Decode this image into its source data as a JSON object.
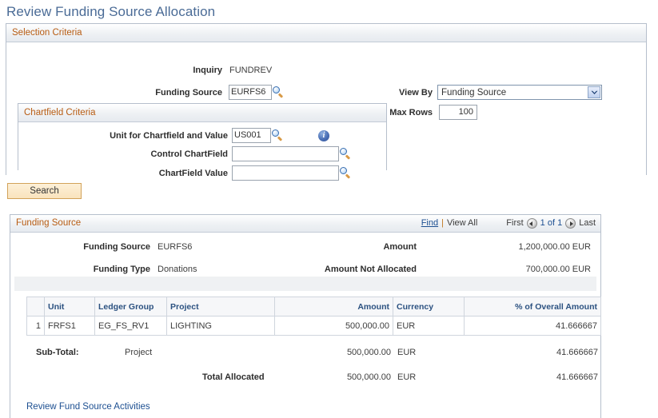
{
  "page": {
    "title": "Review Funding Source Allocation"
  },
  "selection_criteria": {
    "header": "Selection Criteria",
    "inquiry_label": "Inquiry",
    "inquiry_value": "FUNDREV",
    "funding_source_label": "Funding Source",
    "funding_source_value": "EURFS6",
    "view_by_label": "View By",
    "view_by_value": "Funding Source",
    "max_rows_label": "Max Rows",
    "max_rows_value": "100",
    "chartfield": {
      "header": "Chartfield Criteria",
      "unit_label": "Unit for Chartfield and Value",
      "unit_value": "US001",
      "control_chartfield_label": "Control ChartField",
      "control_chartfield_value": "",
      "chartfield_value_label": "ChartField Value",
      "chartfield_value_value": ""
    }
  },
  "search_button_label": "Search",
  "funding_source": {
    "header": "Funding Source",
    "nav": {
      "find": "Find",
      "separator": "|",
      "view_all": "View All",
      "first": "First",
      "position": "1 of 1",
      "last": "Last"
    },
    "summary": {
      "funding_source_label": "Funding Source",
      "funding_source_value": "EURFS6",
      "funding_type_label": "Funding Type",
      "funding_type_value": "Donations",
      "amount_label": "Amount",
      "amount_value": "1,200,000.00 EUR",
      "amount_not_allocated_label": "Amount Not Allocated",
      "amount_not_allocated_value": "700,000.00 EUR"
    },
    "grid": {
      "columns": [
        "",
        "Unit",
        "Ledger Group",
        "Project",
        "Amount",
        "Currency",
        "% of Overall Amount"
      ],
      "rows": [
        {
          "num": "1",
          "unit": "FRFS1",
          "ledger_group": "EG_FS_RV1",
          "project": "LIGHTING",
          "amount": "500,000.00",
          "currency": "EUR",
          "percent": "41.666667"
        }
      ]
    },
    "totals": {
      "subtotal_label": "Sub-Total:",
      "subtotal_by": "Project",
      "subtotal_amount": "500,000.00",
      "subtotal_currency": "EUR",
      "subtotal_percent": "41.666667",
      "total_label": "Total Allocated",
      "total_amount": "500,000.00",
      "total_currency": "EUR",
      "total_percent": "41.666667"
    },
    "review_link": "Review Fund Source Activities"
  },
  "icons": {
    "lookup": "magnifier-icon",
    "info": "info-icon",
    "dropdown": "chevron-down-icon",
    "prev": "prev-arrow-icon",
    "next": "next-arrow-icon"
  },
  "colors": {
    "title": "#4a6b96",
    "group_header_text": "#b85c12",
    "link": "#1c4f91",
    "grid_header_text": "#2b5180",
    "button_bg": "#f9e3bd"
  }
}
